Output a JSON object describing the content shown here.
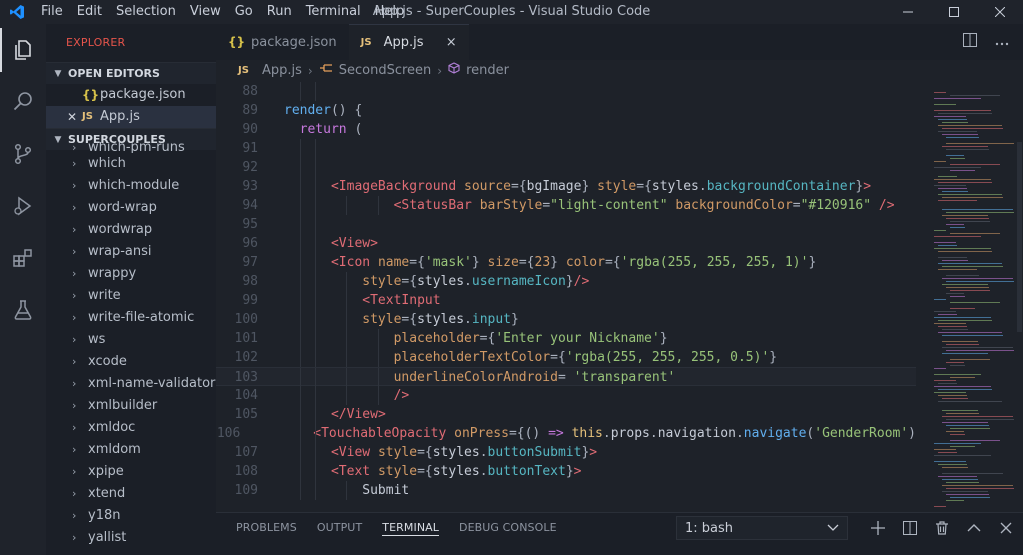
{
  "window": {
    "title": "App.js - SuperCouples - Visual Studio Code",
    "menu": [
      "File",
      "Edit",
      "Selection",
      "View",
      "Go",
      "Run",
      "Terminal",
      "Help"
    ]
  },
  "activity_icons": [
    "explorer-icon",
    "search-icon",
    "source-control-icon",
    "run-debug-icon",
    "extensions-icon",
    "testing-icon"
  ],
  "sidebar": {
    "title": "EXPLORER",
    "open_editors_label": "OPEN EDITORS",
    "open_editors": [
      {
        "badge": "{}",
        "name": "package.json",
        "active": false
      },
      {
        "badge": "JS",
        "name": "App.js",
        "active": true
      }
    ],
    "project_label": "SUPERCOUPLES",
    "tree_partial": "which-pm-runs",
    "tree": [
      "which",
      "which-module",
      "word-wrap",
      "wordwrap",
      "wrap-ansi",
      "wrappy",
      "write",
      "write-file-atomic",
      "ws",
      "xcode",
      "xml-name-validator",
      "xmlbuilder",
      "xmldoc",
      "xmldom",
      "xpipe",
      "xtend",
      "y18n",
      "yallist"
    ]
  },
  "tabs": [
    {
      "badge": "{}",
      "label": "package.json",
      "active": false
    },
    {
      "badge": "JS",
      "label": "App.js",
      "active": true,
      "close": "×"
    }
  ],
  "breadcrumb": {
    "file_badge": "JS",
    "file": "App.js",
    "class": "SecondScreen",
    "method": "render"
  },
  "code": {
    "current_line": 103,
    "lines": [
      {
        "n": 88,
        "indent": 0,
        "tokens": []
      },
      {
        "n": 89,
        "indent": 0,
        "tokens": [
          [
            "fn",
            "render"
          ],
          [
            "pun",
            "() {"
          ]
        ]
      },
      {
        "n": 90,
        "indent": 1,
        "tokens": [
          [
            "kw",
            "return"
          ],
          [
            "pun",
            " ("
          ]
        ]
      },
      {
        "n": 91,
        "indent": 0,
        "tokens": []
      },
      {
        "n": 92,
        "indent": 0,
        "tokens": []
      },
      {
        "n": 93,
        "indent": 3,
        "tokens": [
          [
            "tag",
            "<ImageBackground"
          ],
          [
            "plain",
            " "
          ],
          [
            "attr",
            "source"
          ],
          [
            "pun",
            "={"
          ],
          [
            "plain",
            "bgImage"
          ],
          [
            "pun",
            "} "
          ],
          [
            "attr",
            "style"
          ],
          [
            "pun",
            "={"
          ],
          [
            "plain",
            "styles"
          ],
          [
            "pun",
            "."
          ],
          [
            "prop",
            "backgroundContainer"
          ],
          [
            "pun",
            "}"
          ],
          [
            "tag",
            ">"
          ]
        ]
      },
      {
        "n": 94,
        "indent": 7,
        "tokens": [
          [
            "tag",
            "<StatusBar"
          ],
          [
            "plain",
            " "
          ],
          [
            "attr",
            "barStyle"
          ],
          [
            "pun",
            "="
          ],
          [
            "str",
            "\"light-content\""
          ],
          [
            "plain",
            " "
          ],
          [
            "attr",
            "backgroundColor"
          ],
          [
            "pun",
            "="
          ],
          [
            "str",
            "\"#120916\""
          ],
          [
            "plain",
            " "
          ],
          [
            "tag",
            "/>"
          ]
        ]
      },
      {
        "n": 95,
        "indent": 0,
        "tokens": []
      },
      {
        "n": 96,
        "indent": 3,
        "tokens": [
          [
            "tag",
            "<View"
          ],
          [
            "tag",
            ">"
          ]
        ]
      },
      {
        "n": 97,
        "indent": 3,
        "tokens": [
          [
            "tag",
            "<Icon"
          ],
          [
            "plain",
            " "
          ],
          [
            "attr",
            "name"
          ],
          [
            "pun",
            "={"
          ],
          [
            "str",
            "'mask'"
          ],
          [
            "pun",
            "} "
          ],
          [
            "attr",
            "size"
          ],
          [
            "pun",
            "={"
          ],
          [
            "attr",
            "23"
          ],
          [
            "pun",
            "} "
          ],
          [
            "attr",
            "color"
          ],
          [
            "pun",
            "={"
          ],
          [
            "str",
            "'rgba(255, 255, 255, 1)'"
          ],
          [
            "pun",
            "}"
          ]
        ]
      },
      {
        "n": 98,
        "indent": 5,
        "tokens": [
          [
            "attr",
            "style"
          ],
          [
            "pun",
            "={"
          ],
          [
            "plain",
            "styles"
          ],
          [
            "pun",
            "."
          ],
          [
            "prop",
            "usernameIcon"
          ],
          [
            "pun",
            "}"
          ],
          [
            "tag",
            "/>"
          ]
        ]
      },
      {
        "n": 99,
        "indent": 5,
        "tokens": [
          [
            "tag",
            "<TextInput"
          ]
        ]
      },
      {
        "n": 100,
        "indent": 5,
        "tokens": [
          [
            "attr",
            "style"
          ],
          [
            "pun",
            "={"
          ],
          [
            "plain",
            "styles"
          ],
          [
            "pun",
            "."
          ],
          [
            "prop",
            "input"
          ],
          [
            "pun",
            "}"
          ]
        ]
      },
      {
        "n": 101,
        "indent": 7,
        "tokens": [
          [
            "attr",
            "placeholder"
          ],
          [
            "pun",
            "={"
          ],
          [
            "str",
            "'Enter your Nickname'"
          ],
          [
            "pun",
            "}"
          ]
        ]
      },
      {
        "n": 102,
        "indent": 7,
        "tokens": [
          [
            "attr",
            "placeholderTextColor"
          ],
          [
            "pun",
            "={"
          ],
          [
            "str",
            "'rgba(255, 255, 255, 0.5)'"
          ],
          [
            "pun",
            "}"
          ]
        ]
      },
      {
        "n": 103,
        "indent": 7,
        "tokens": [
          [
            "attr",
            "underlineColorAndroid"
          ],
          [
            "pun",
            "= "
          ],
          [
            "str",
            "'transparent'"
          ]
        ]
      },
      {
        "n": 104,
        "indent": 7,
        "tokens": [
          [
            "tag",
            "/>"
          ]
        ]
      },
      {
        "n": 105,
        "indent": 3,
        "tokens": [
          [
            "tag",
            "</View"
          ],
          [
            "tag",
            ">"
          ]
        ]
      },
      {
        "n": 106,
        "indent": 3,
        "tokens": [
          [
            "tag",
            "<TouchableOpacity"
          ],
          [
            "plain",
            " "
          ],
          [
            "attr",
            "onPress"
          ],
          [
            "pun",
            "={"
          ],
          [
            "pun",
            "() "
          ],
          [
            "kw",
            "=>"
          ],
          [
            "plain",
            " "
          ],
          [
            "this",
            "this"
          ],
          [
            "pun",
            "."
          ],
          [
            "plain",
            "props"
          ],
          [
            "pun",
            "."
          ],
          [
            "plain",
            "navigation"
          ],
          [
            "pun",
            "."
          ],
          [
            "fn",
            "navigate"
          ],
          [
            "pun",
            "("
          ],
          [
            "str",
            "'GenderRoom'"
          ],
          [
            "pun",
            ")"
          ]
        ]
      },
      {
        "n": 107,
        "indent": 3,
        "tokens": [
          [
            "tag",
            "<View"
          ],
          [
            "plain",
            " "
          ],
          [
            "attr",
            "style"
          ],
          [
            "pun",
            "={"
          ],
          [
            "plain",
            "styles"
          ],
          [
            "pun",
            "."
          ],
          [
            "prop",
            "buttonSubmit"
          ],
          [
            "pun",
            "}"
          ],
          [
            "tag",
            ">"
          ]
        ]
      },
      {
        "n": 108,
        "indent": 3,
        "tokens": [
          [
            "tag",
            "<Text"
          ],
          [
            "plain",
            " "
          ],
          [
            "attr",
            "style"
          ],
          [
            "pun",
            "={"
          ],
          [
            "plain",
            "styles"
          ],
          [
            "pun",
            "."
          ],
          [
            "prop",
            "buttonText"
          ],
          [
            "pun",
            "}"
          ],
          [
            "tag",
            ">"
          ]
        ]
      },
      {
        "n": 109,
        "indent": 5,
        "tokens": [
          [
            "plain",
            "Submit"
          ]
        ]
      }
    ]
  },
  "panel": {
    "tabs": [
      {
        "label": "PROBLEMS",
        "active": false
      },
      {
        "label": "OUTPUT",
        "active": false
      },
      {
        "label": "TERMINAL",
        "active": true
      },
      {
        "label": "DEBUG CONSOLE",
        "active": false
      }
    ],
    "terminal_selected": "1: bash"
  },
  "colors": {
    "accent_explorer_title": "#e5544b",
    "keyword": "#c678dd",
    "tag": "#e06c75",
    "attribute": "#d19a66",
    "string": "#98c379",
    "function": "#61afef"
  }
}
